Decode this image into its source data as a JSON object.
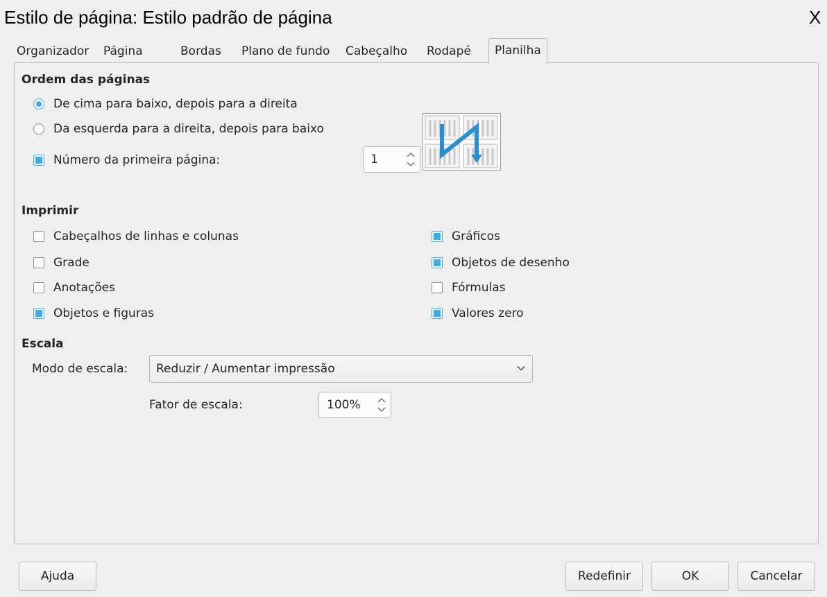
{
  "dialog": {
    "title": "Estilo de página: Estilo padrão de página",
    "close_label": "X"
  },
  "tabs": [
    "Organizador",
    "Página",
    "Bordas",
    "Plano de fundo",
    "Cabeçalho",
    "Rodapé",
    "Planilha"
  ],
  "active_tab": "Planilha",
  "page_order": {
    "title": "Ordem das páginas",
    "options": [
      {
        "label": "De cima para baixo, depois para a direita",
        "selected": true
      },
      {
        "label": "Da esquerda para a direita, depois para baixo",
        "selected": false
      }
    ],
    "first_page_number": {
      "label": "Número da primeira página:",
      "checked": true,
      "value": "1"
    }
  },
  "print": {
    "title": "Imprimir",
    "left": [
      {
        "label": "Cabeçalhos de linhas e colunas",
        "checked": false
      },
      {
        "label": "Grade",
        "checked": false
      },
      {
        "label": "Anotações",
        "checked": false
      },
      {
        "label": "Objetos e figuras",
        "checked": true
      }
    ],
    "right": [
      {
        "label": "Gráficos",
        "checked": true
      },
      {
        "label": "Objetos de desenho",
        "checked": true
      },
      {
        "label": "Fórmulas",
        "checked": false
      },
      {
        "label": "Valores zero",
        "checked": true
      }
    ]
  },
  "scale": {
    "title": "Escala",
    "mode_label": "Modo de escala:",
    "mode_value": "Reduzir / Aumentar impressão",
    "factor_label": "Fator de escala:",
    "factor_value": "100%"
  },
  "buttons": {
    "help": "Ajuda",
    "reset": "Redefinir",
    "ok": "OK",
    "cancel": "Cancelar"
  },
  "colors": {
    "accent": "#3daee9",
    "background": "#efefef",
    "border": "#b8b8b8"
  }
}
